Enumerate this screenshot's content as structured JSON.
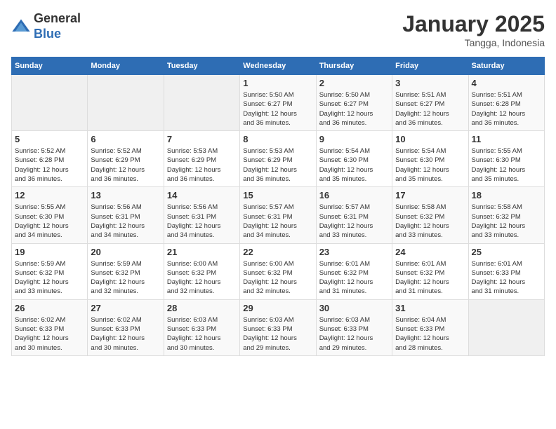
{
  "header": {
    "logo_line1": "General",
    "logo_line2": "Blue",
    "month_title": "January 2025",
    "subtitle": "Tangga, Indonesia"
  },
  "days_of_week": [
    "Sunday",
    "Monday",
    "Tuesday",
    "Wednesday",
    "Thursday",
    "Friday",
    "Saturday"
  ],
  "weeks": [
    [
      {
        "day": "",
        "info": ""
      },
      {
        "day": "",
        "info": ""
      },
      {
        "day": "",
        "info": ""
      },
      {
        "day": "1",
        "info": "Sunrise: 5:50 AM\nSunset: 6:27 PM\nDaylight: 12 hours\nand 36 minutes."
      },
      {
        "day": "2",
        "info": "Sunrise: 5:50 AM\nSunset: 6:27 PM\nDaylight: 12 hours\nand 36 minutes."
      },
      {
        "day": "3",
        "info": "Sunrise: 5:51 AM\nSunset: 6:27 PM\nDaylight: 12 hours\nand 36 minutes."
      },
      {
        "day": "4",
        "info": "Sunrise: 5:51 AM\nSunset: 6:28 PM\nDaylight: 12 hours\nand 36 minutes."
      }
    ],
    [
      {
        "day": "5",
        "info": "Sunrise: 5:52 AM\nSunset: 6:28 PM\nDaylight: 12 hours\nand 36 minutes."
      },
      {
        "day": "6",
        "info": "Sunrise: 5:52 AM\nSunset: 6:29 PM\nDaylight: 12 hours\nand 36 minutes."
      },
      {
        "day": "7",
        "info": "Sunrise: 5:53 AM\nSunset: 6:29 PM\nDaylight: 12 hours\nand 36 minutes."
      },
      {
        "day": "8",
        "info": "Sunrise: 5:53 AM\nSunset: 6:29 PM\nDaylight: 12 hours\nand 36 minutes."
      },
      {
        "day": "9",
        "info": "Sunrise: 5:54 AM\nSunset: 6:30 PM\nDaylight: 12 hours\nand 35 minutes."
      },
      {
        "day": "10",
        "info": "Sunrise: 5:54 AM\nSunset: 6:30 PM\nDaylight: 12 hours\nand 35 minutes."
      },
      {
        "day": "11",
        "info": "Sunrise: 5:55 AM\nSunset: 6:30 PM\nDaylight: 12 hours\nand 35 minutes."
      }
    ],
    [
      {
        "day": "12",
        "info": "Sunrise: 5:55 AM\nSunset: 6:30 PM\nDaylight: 12 hours\nand 34 minutes."
      },
      {
        "day": "13",
        "info": "Sunrise: 5:56 AM\nSunset: 6:31 PM\nDaylight: 12 hours\nand 34 minutes."
      },
      {
        "day": "14",
        "info": "Sunrise: 5:56 AM\nSunset: 6:31 PM\nDaylight: 12 hours\nand 34 minutes."
      },
      {
        "day": "15",
        "info": "Sunrise: 5:57 AM\nSunset: 6:31 PM\nDaylight: 12 hours\nand 34 minutes."
      },
      {
        "day": "16",
        "info": "Sunrise: 5:57 AM\nSunset: 6:31 PM\nDaylight: 12 hours\nand 33 minutes."
      },
      {
        "day": "17",
        "info": "Sunrise: 5:58 AM\nSunset: 6:32 PM\nDaylight: 12 hours\nand 33 minutes."
      },
      {
        "day": "18",
        "info": "Sunrise: 5:58 AM\nSunset: 6:32 PM\nDaylight: 12 hours\nand 33 minutes."
      }
    ],
    [
      {
        "day": "19",
        "info": "Sunrise: 5:59 AM\nSunset: 6:32 PM\nDaylight: 12 hours\nand 33 minutes."
      },
      {
        "day": "20",
        "info": "Sunrise: 5:59 AM\nSunset: 6:32 PM\nDaylight: 12 hours\nand 32 minutes."
      },
      {
        "day": "21",
        "info": "Sunrise: 6:00 AM\nSunset: 6:32 PM\nDaylight: 12 hours\nand 32 minutes."
      },
      {
        "day": "22",
        "info": "Sunrise: 6:00 AM\nSunset: 6:32 PM\nDaylight: 12 hours\nand 32 minutes."
      },
      {
        "day": "23",
        "info": "Sunrise: 6:01 AM\nSunset: 6:32 PM\nDaylight: 12 hours\nand 31 minutes."
      },
      {
        "day": "24",
        "info": "Sunrise: 6:01 AM\nSunset: 6:32 PM\nDaylight: 12 hours\nand 31 minutes."
      },
      {
        "day": "25",
        "info": "Sunrise: 6:01 AM\nSunset: 6:33 PM\nDaylight: 12 hours\nand 31 minutes."
      }
    ],
    [
      {
        "day": "26",
        "info": "Sunrise: 6:02 AM\nSunset: 6:33 PM\nDaylight: 12 hours\nand 30 minutes."
      },
      {
        "day": "27",
        "info": "Sunrise: 6:02 AM\nSunset: 6:33 PM\nDaylight: 12 hours\nand 30 minutes."
      },
      {
        "day": "28",
        "info": "Sunrise: 6:03 AM\nSunset: 6:33 PM\nDaylight: 12 hours\nand 30 minutes."
      },
      {
        "day": "29",
        "info": "Sunrise: 6:03 AM\nSunset: 6:33 PM\nDaylight: 12 hours\nand 29 minutes."
      },
      {
        "day": "30",
        "info": "Sunrise: 6:03 AM\nSunset: 6:33 PM\nDaylight: 12 hours\nand 29 minutes."
      },
      {
        "day": "31",
        "info": "Sunrise: 6:04 AM\nSunset: 6:33 PM\nDaylight: 12 hours\nand 28 minutes."
      },
      {
        "day": "",
        "info": ""
      }
    ]
  ]
}
